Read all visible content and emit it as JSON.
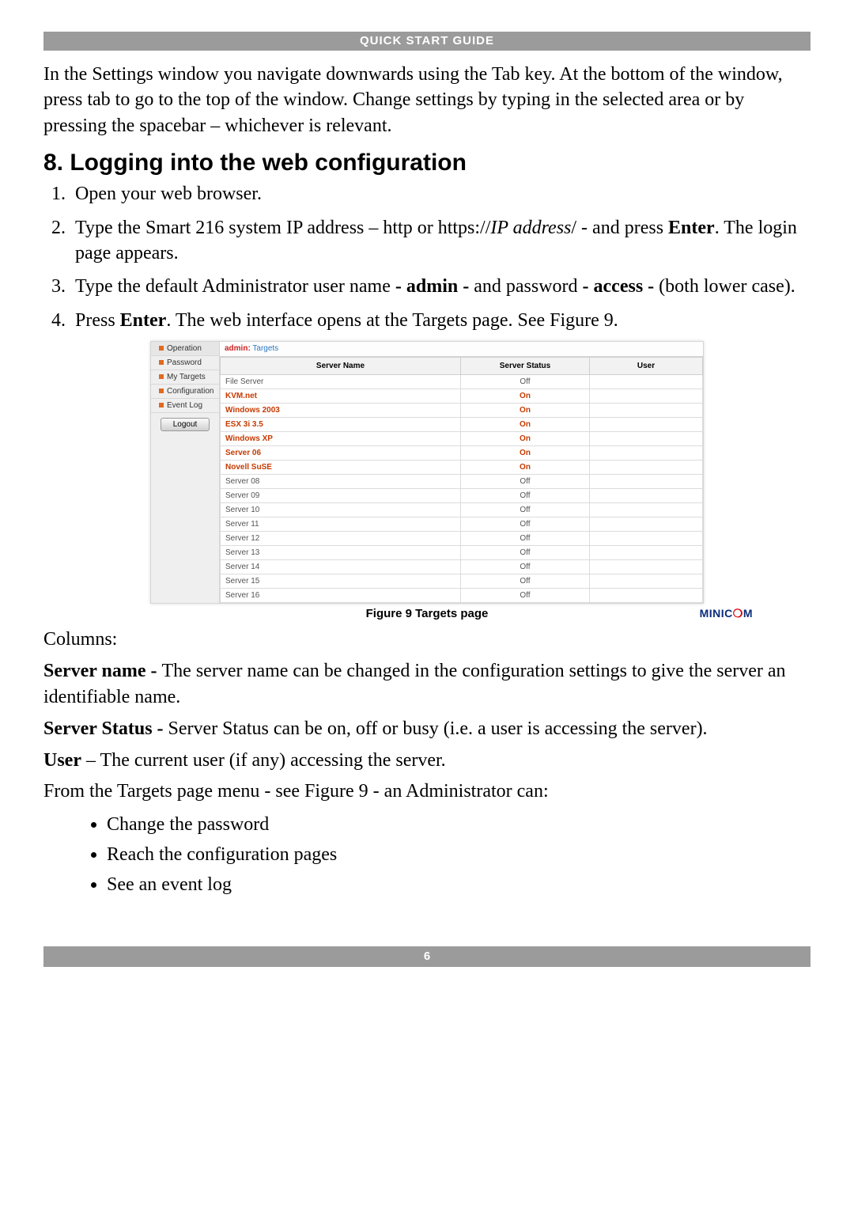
{
  "header": {
    "title": "QUICK START GUIDE"
  },
  "footer": {
    "page_number": "6"
  },
  "intro_paragraph": "In the Settings window you navigate downwards using the Tab key. At the bottom of the window, press tab to go to the top of the window. Change settings by typing in the selected area or by pressing the spacebar – whichever is relevant.",
  "section_title": "8. Logging into the web configuration",
  "steps": {
    "s1": "Open your web browser.",
    "s2a": "Type the Smart 216 system IP address – http or https://",
    "s2b": "IP address",
    "s2c": "/ - and press ",
    "s2d": "Enter",
    "s2e": ". The login page appears.",
    "s3a": "Type the default Administrator user name ",
    "s3b": "- admin -",
    "s3c": " and password ",
    "s3d": "- access -",
    "s3e": " (both lower case).",
    "s4a": "Press ",
    "s4b": "Enter",
    "s4c": ". The web interface opens at the Targets page. See Figure 9."
  },
  "figure": {
    "caption": "Figure 9 Targets page",
    "logo_a": "MINIC",
    "logo_b": "M",
    "sidebar": {
      "items": [
        "Operation",
        "Password",
        "My Targets",
        "Configuration",
        "Event Log"
      ],
      "logout": "Logout"
    },
    "breadcrumb": {
      "user": "admin:",
      "page": "Targets"
    },
    "columns": {
      "name": "Server Name",
      "status": "Server Status",
      "user": "User"
    },
    "rows": [
      {
        "name": "File Server",
        "status": "Off",
        "on": false
      },
      {
        "name": "KVM.net",
        "status": "On",
        "on": true
      },
      {
        "name": "Windows 2003",
        "status": "On",
        "on": true
      },
      {
        "name": "ESX 3i 3.5",
        "status": "On",
        "on": true
      },
      {
        "name": "Windows XP",
        "status": "On",
        "on": true
      },
      {
        "name": "Server 06",
        "status": "On",
        "on": true
      },
      {
        "name": "Novell SuSE",
        "status": "On",
        "on": true
      },
      {
        "name": "Server 08",
        "status": "Off",
        "on": false
      },
      {
        "name": "Server 09",
        "status": "Off",
        "on": false
      },
      {
        "name": "Server 10",
        "status": "Off",
        "on": false
      },
      {
        "name": "Server 11",
        "status": "Off",
        "on": false
      },
      {
        "name": "Server 12",
        "status": "Off",
        "on": false
      },
      {
        "name": "Server 13",
        "status": "Off",
        "on": false
      },
      {
        "name": "Server 14",
        "status": "Off",
        "on": false
      },
      {
        "name": "Server 15",
        "status": "Off",
        "on": false
      },
      {
        "name": "Server 16",
        "status": "Off",
        "on": false
      }
    ]
  },
  "columns_label": "Columns:",
  "explain": {
    "srvname_b": "Server name - ",
    "srvname_t": "The server name can be changed in the configuration settings to give the server an identifiable name.",
    "status_b": "Server Status - ",
    "status_t": "Server Status can be on, off or busy (i.e. a user is accessing the server).",
    "user_b": "User",
    "user_t": " – The current user (if any) accessing the server."
  },
  "menu_intro": "From the Targets page menu - see Figure 9 - an Administrator can:",
  "menu_items": [
    "Change the password",
    "Reach the configuration pages",
    "See an event log"
  ]
}
